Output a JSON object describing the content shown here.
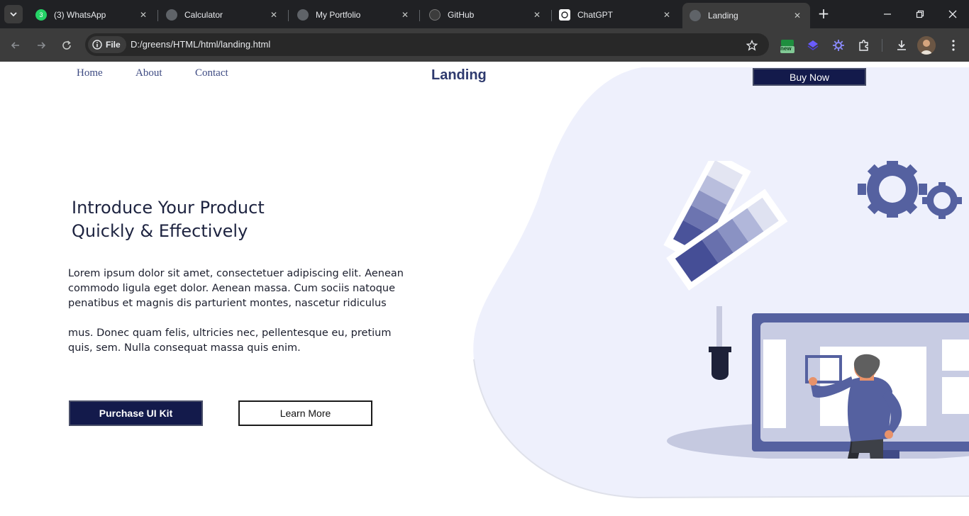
{
  "browser": {
    "tabs": [
      {
        "title": "(3) WhatsApp",
        "badge": "3",
        "icon": "whatsapp-icon",
        "active": false
      },
      {
        "title": "Calculator",
        "icon": "globe-icon",
        "active": false
      },
      {
        "title": "My Portfolio",
        "icon": "globe-icon",
        "active": false
      },
      {
        "title": "GitHub",
        "icon": "github-icon",
        "active": false
      },
      {
        "title": "ChatGPT",
        "icon": "chatgpt-icon",
        "active": false
      },
      {
        "title": "Landing",
        "icon": "globe-icon",
        "active": true
      }
    ],
    "site_chip": "File",
    "url": "D:/greens/HTML/html/landing.html",
    "extension_badge": "new",
    "colors": {
      "tabbar": "#202124",
      "toolbar": "#3c3c3c",
      "omnibox": "#282828"
    }
  },
  "page": {
    "nav": {
      "home": "Home",
      "about": "About",
      "contact": "Contact"
    },
    "brand": "Landing",
    "buy_button": "Buy Now",
    "hero": {
      "headline_line1": "Introduce Your Product",
      "headline_line2": "Quickly & Effectively",
      "paragraph1": "Lorem ipsum dolor sit amet, consectetuer adipiscing elit. Aenean commodo ligula eget dolor. Aenean massa. Cum sociis natoque penatibus et magnis dis parturient montes, nascetur ridiculus",
      "paragraph2": "mus. Donec quam felis, ultricies nec, pellentesque eu, pretium quis, sem. Nulla consequat massa quis enim.",
      "primary_button": "Purchase UI Kit",
      "secondary_button": "Learn More"
    },
    "colors": {
      "navy": "#131a4b",
      "blob": "#eef0fc",
      "accent": "#5561a0"
    }
  }
}
